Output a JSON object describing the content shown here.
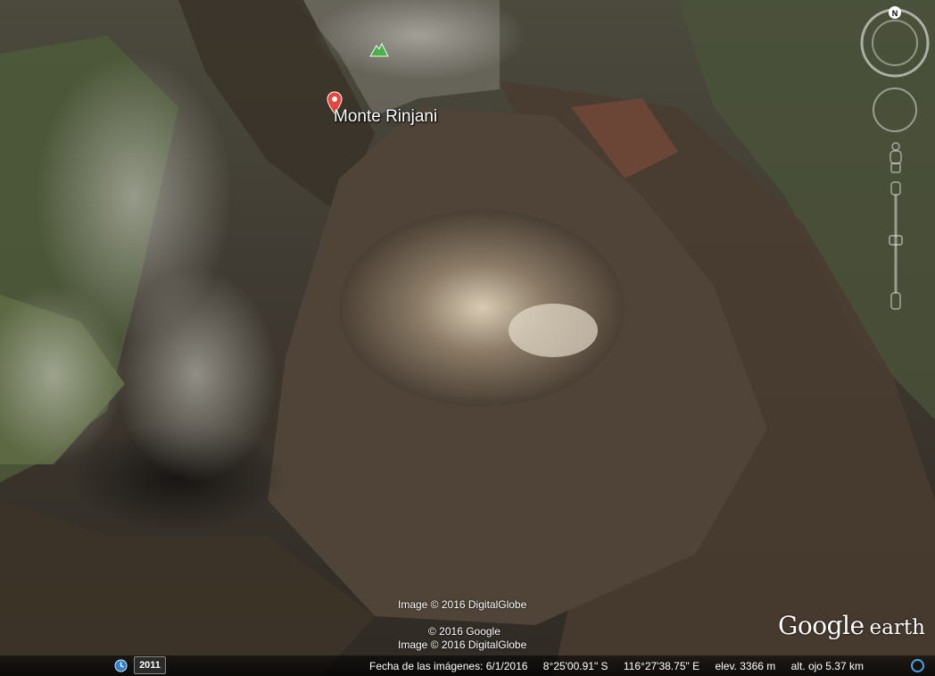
{
  "place": {
    "name": "Monte Rinjani"
  },
  "credits": {
    "image_top": "Image © 2016 DigitalGlobe",
    "google": "© 2016 Google",
    "image_bottom": "Image © 2016 DigitalGlobe"
  },
  "status": {
    "date": "Fecha de las imágenes: 6/1/2016",
    "lat": "8°25'00.91\" S",
    "lon": "116°27'38.75\" E",
    "elev": "elev.  3366 m",
    "eye_alt": "alt. ojo   5.37 km"
  },
  "history": {
    "year": "2011"
  },
  "brand": {
    "google": "Google",
    "earth": "earth"
  },
  "compass": {
    "north": "N"
  },
  "colors": {
    "pin": "#e8453c",
    "peak": "#4caf50",
    "loading": "#4fa3e6"
  }
}
